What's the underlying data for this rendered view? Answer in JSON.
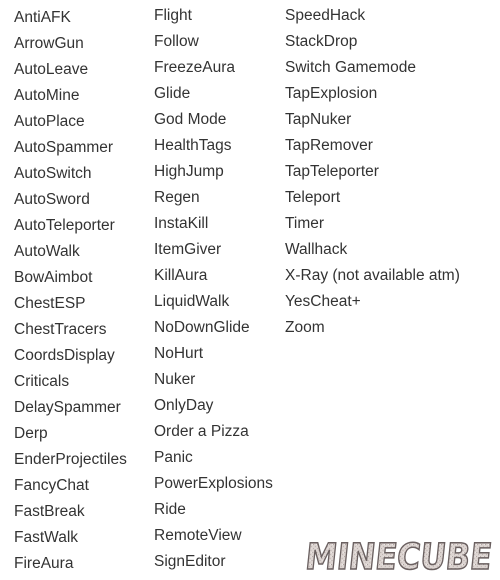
{
  "columns": [
    [
      "AntiAFK",
      "ArrowGun",
      "AutoLeave",
      "AutoMine",
      "AutoPlace",
      "AutoSpammer",
      "AutoSwitch",
      "AutoSword",
      "AutoTeleporter",
      "AutoWalk",
      "BowAimbot",
      "ChestESP",
      "ChestTracers",
      "CoordsDisplay",
      "Criticals",
      "DelaySpammer",
      "Derp",
      "EnderProjectiles",
      "FancyChat",
      "FastBreak",
      "FastWalk",
      "FireAura"
    ],
    [
      "Flight",
      "Follow",
      "FreezeAura",
      "Glide",
      "God Mode",
      "HealthTags",
      "HighJump",
      "Regen",
      "InstaKill",
      "ItemGiver",
      "KillAura",
      "LiquidWalk",
      "NoDownGlide",
      "NoHurt",
      "Nuker",
      "OnlyDay",
      "Order a Pizza",
      "Panic",
      "PowerExplosions",
      "Ride",
      "RemoteView",
      "SignEditor"
    ],
    [
      "SpeedHack",
      "StackDrop",
      "Switch Gamemode",
      "TapExplosion",
      "TapNuker",
      "TapRemover",
      "TapTeleporter",
      "Teleport",
      "Timer",
      "Wallhack",
      "X-Ray (not available atm)",
      "YesCheat+",
      "Zoom"
    ]
  ],
  "logo": {
    "text": "MINECUBE"
  },
  "colors": {
    "text": "#333333",
    "logo_fill": "#d8d0cc",
    "logo_outline": "#6a6060"
  }
}
